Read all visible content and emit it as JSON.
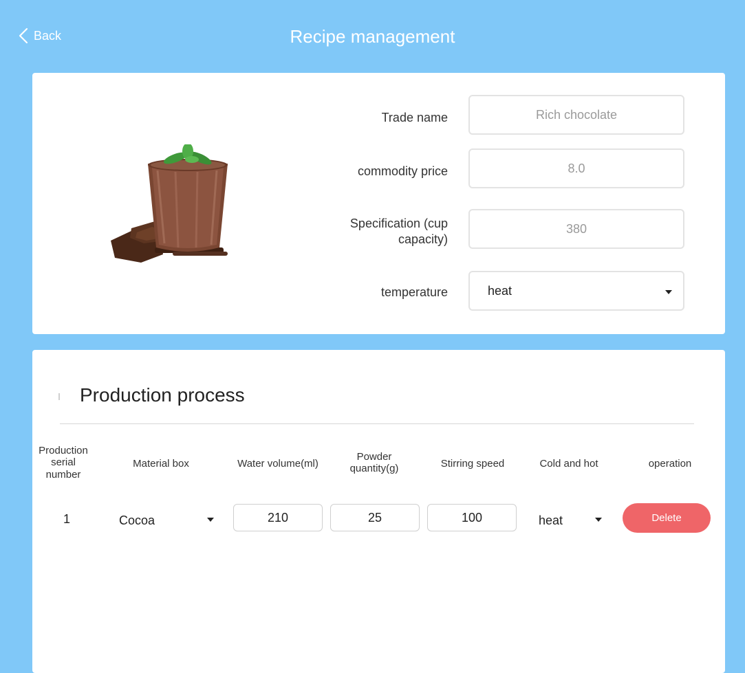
{
  "header": {
    "back_label": "Back",
    "title": "Recipe management"
  },
  "product": {
    "image_icon": "chocolate-drink-image",
    "trade_name_label": "Trade name",
    "trade_name_value": "Rich chocolate",
    "price_label": "commodity price",
    "price_value": "8.0",
    "spec_label": "Specification (cup capacity)",
    "spec_value": "380",
    "temperature_label": "temperature",
    "temperature_value": "heat"
  },
  "process": {
    "title": "Production process",
    "columns": [
      "Production serial number",
      "Material box",
      "Water volume(ml)",
      "Powder quantity(g)",
      "Stirring speed",
      "Cold and hot",
      "operation"
    ],
    "rows": [
      {
        "serial": "1",
        "material": "Cocoa",
        "water": "210",
        "powder": "25",
        "speed": "100",
        "temp": "heat",
        "delete_label": "Delete"
      }
    ]
  },
  "colors": {
    "background": "#80c8f8",
    "delete": "#ef6568"
  }
}
